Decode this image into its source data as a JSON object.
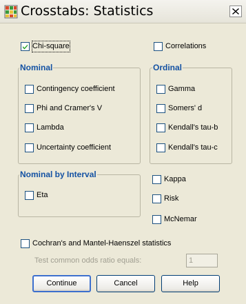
{
  "window": {
    "title": "Crosstabs: Statistics",
    "close_glyph": "×"
  },
  "top": {
    "chi_square": {
      "label": "Chi-square",
      "checked": true
    },
    "correlations": {
      "label": "Correlations",
      "checked": false
    }
  },
  "nominal": {
    "title": "Nominal",
    "items": [
      {
        "label": "Contingency coefficient",
        "checked": false
      },
      {
        "label": "Phi and Cramer's V",
        "checked": false
      },
      {
        "label": "Lambda",
        "checked": false
      },
      {
        "label": "Uncertainty coefficient",
        "checked": false
      }
    ]
  },
  "ordinal": {
    "title": "Ordinal",
    "items": [
      {
        "label": "Gamma",
        "checked": false
      },
      {
        "label": "Somers' d",
        "checked": false
      },
      {
        "label": "Kendall's tau-b",
        "checked": false
      },
      {
        "label": "Kendall's tau-c",
        "checked": false
      }
    ]
  },
  "nominal_by_interval": {
    "title": "Nominal by Interval",
    "items": [
      {
        "label": "Eta",
        "checked": false
      }
    ]
  },
  "other": {
    "items": [
      {
        "label": "Kappa",
        "checked": false
      },
      {
        "label": "Risk",
        "checked": false
      },
      {
        "label": "McNemar",
        "checked": false
      }
    ]
  },
  "cochran": {
    "label": "Cochran's and Mantel-Haenszel statistics",
    "checked": false,
    "odds_label": "Test common odds ratio equals:",
    "odds_value": "1"
  },
  "buttons": {
    "continue": "Continue",
    "cancel": "Cancel",
    "help": "Help"
  },
  "colors": {
    "group_title": "#1452a3",
    "checkbox_border": "#1c5180",
    "check_mark": "#21a121",
    "disabled_text": "#a09e91",
    "dialog_bg": "#ece9d8"
  },
  "icons": {
    "app": "spss-crosstabs-icon",
    "check": "check-icon",
    "close": "close-icon"
  }
}
